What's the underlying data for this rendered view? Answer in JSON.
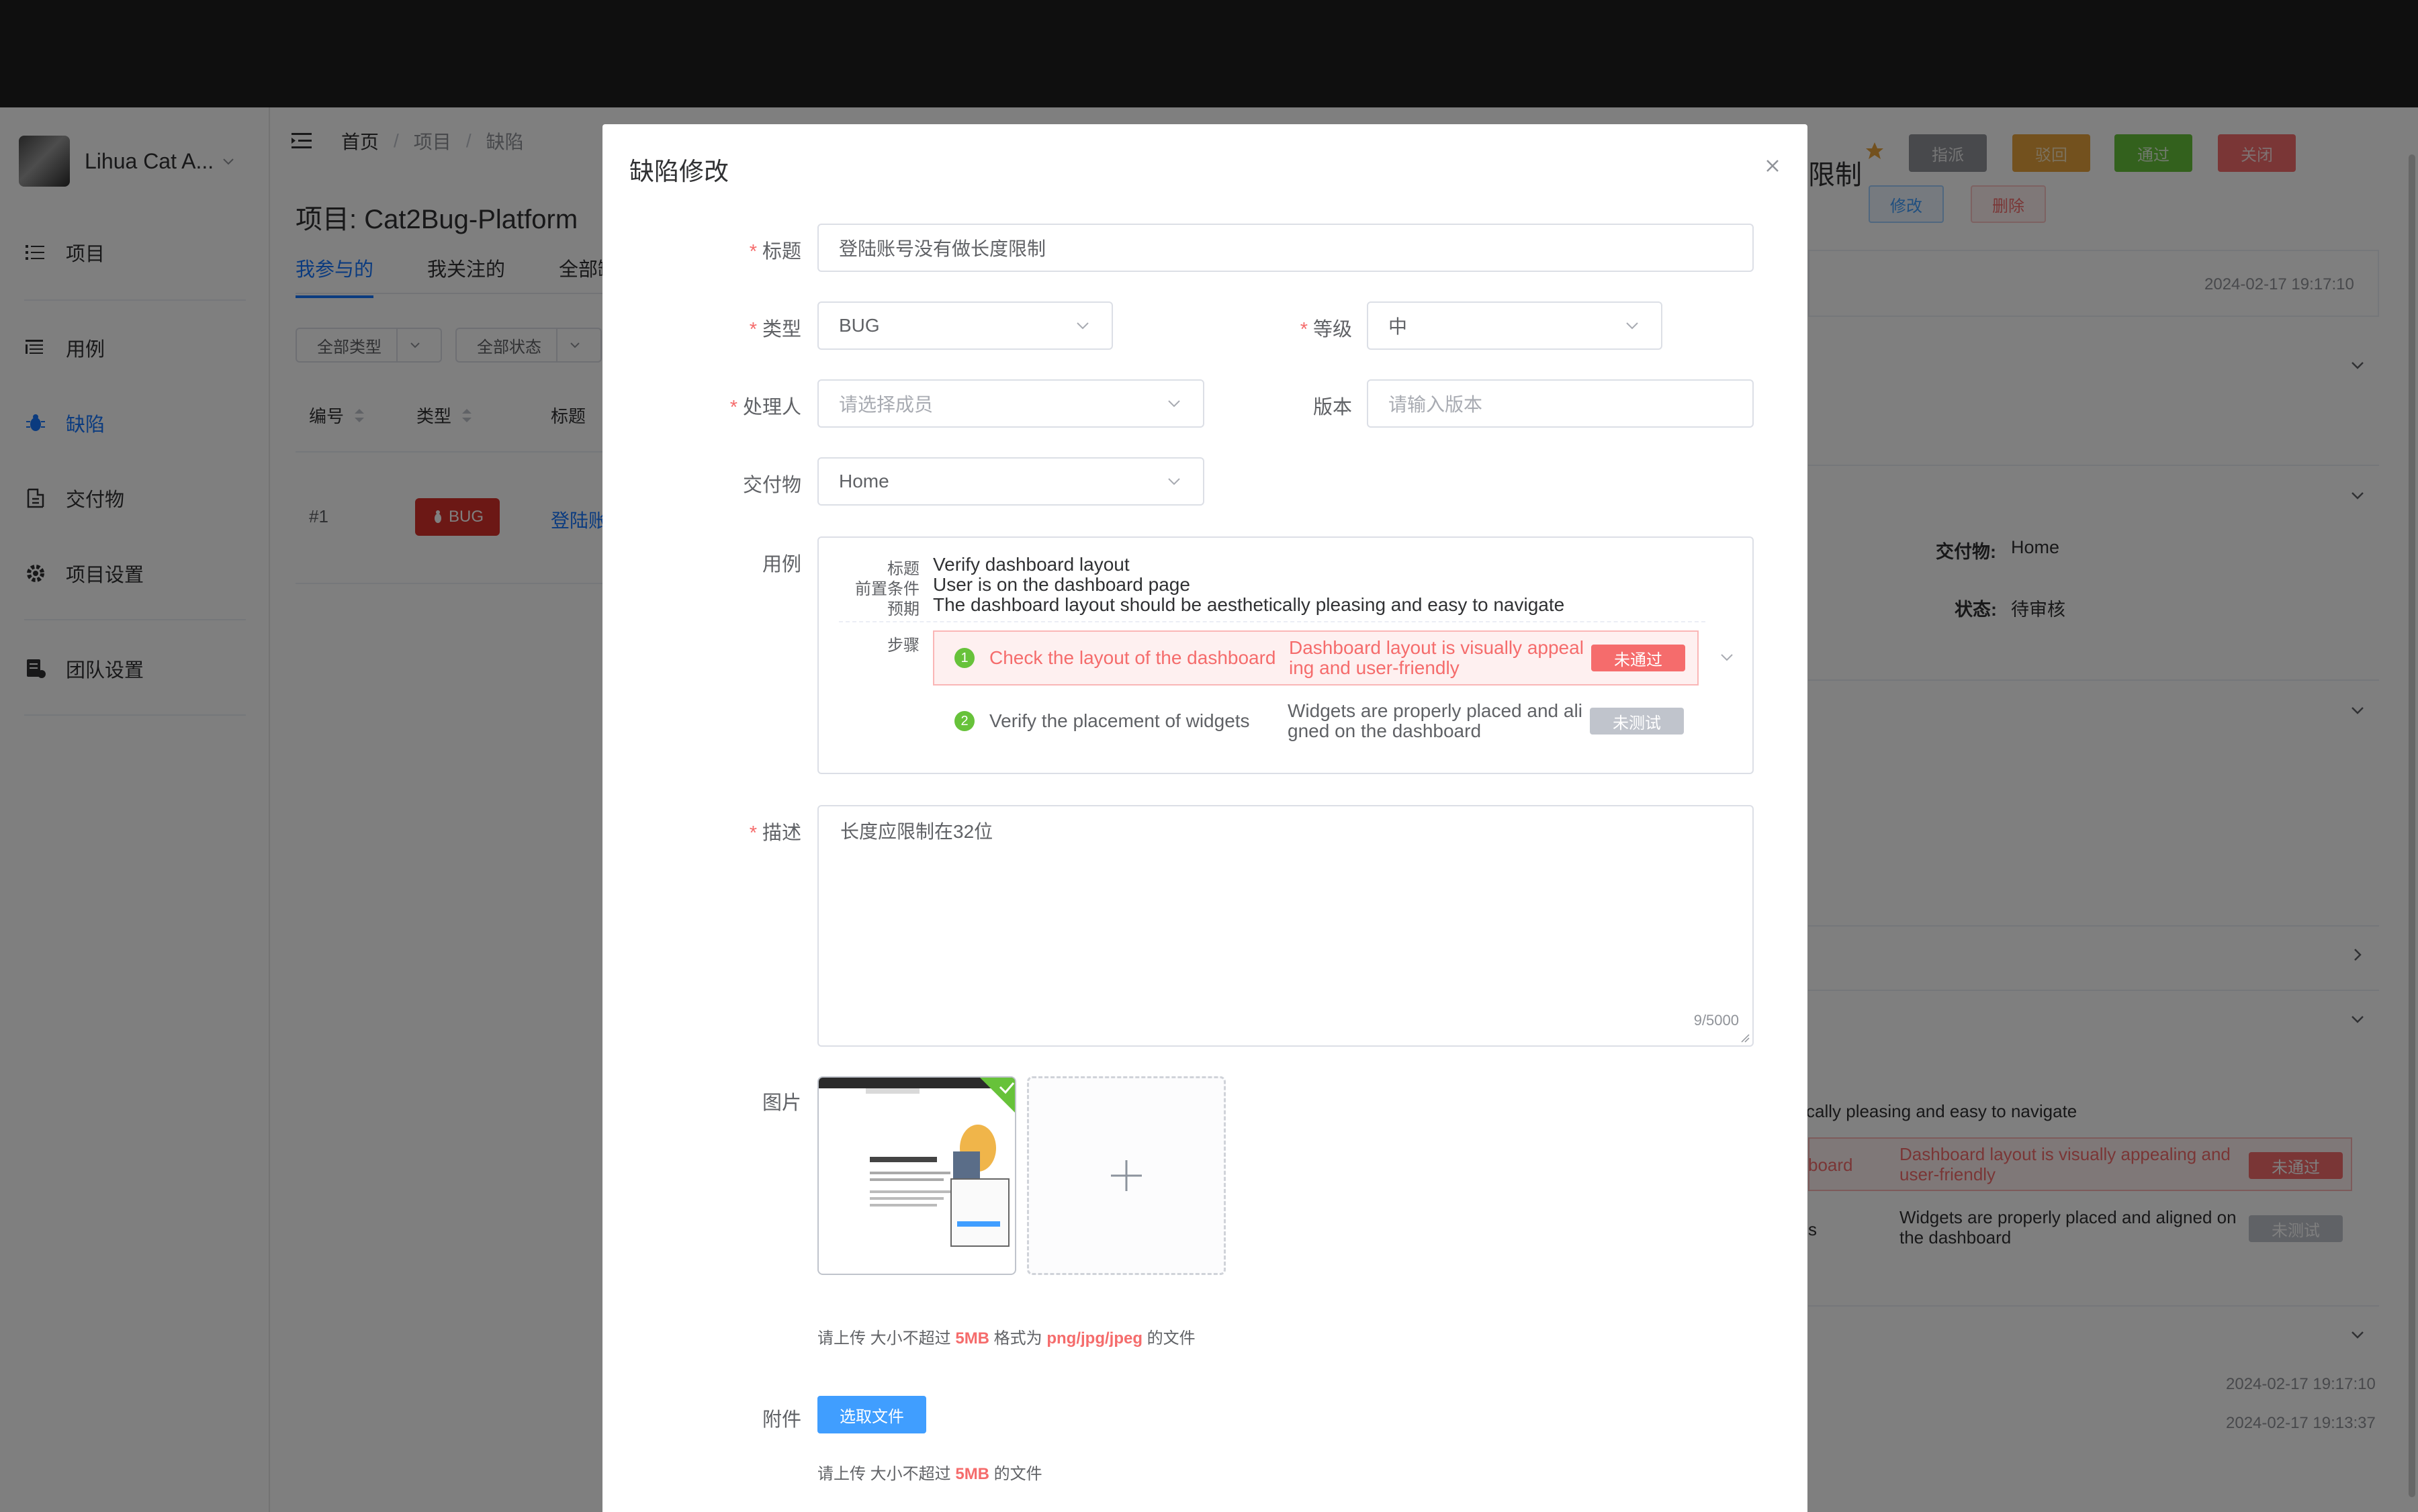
{
  "sidebar": {
    "team_name": "Lihua Cat A...",
    "items": [
      {
        "label": "项目",
        "icon": "list-icon"
      },
      {
        "label": "用例",
        "icon": "tasks-icon"
      },
      {
        "label": "缺陷",
        "icon": "bug-icon"
      },
      {
        "label": "交付物",
        "icon": "deliverable-icon"
      },
      {
        "label": "项目设置",
        "icon": "gear-icon"
      },
      {
        "label": "团队设置",
        "icon": "team-settings-icon"
      }
    ]
  },
  "background": {
    "breadcrumb": [
      "首页",
      "项目",
      "缺陷"
    ],
    "project_title": "项目: Cat2Bug-Platform",
    "tabs": [
      "我参与的",
      "我关注的",
      "全部缺"
    ],
    "filters": [
      "全部类型",
      "全部状态"
    ],
    "columns": [
      "编号",
      "类型",
      "标题"
    ],
    "row": {
      "id": "#1",
      "type": "BUG",
      "title": "登陆账"
    },
    "detail": {
      "title_fragment": "限制",
      "buttons": [
        "指派",
        "驳回",
        "通过",
        "关闭",
        "修改",
        "删除"
      ],
      "time1": "2024-02-17 19:17:10",
      "deliverable_label": "交付物:",
      "deliverable_value": "Home",
      "status_label": "状态:",
      "status_value": "待审核",
      "expected_fragment": "tically pleasing and easy to navigate",
      "step1_fragment": "board",
      "step1_result": "Dashboard layout is visually appealing and user-friendly",
      "step1_status": "未通过",
      "step2_fragment": "s",
      "step2_result": "Widgets are properly placed and aligned on the dashboard",
      "step2_status": "未测试",
      "time2": "2024-02-17 19:17:10",
      "time3": "2024-02-17 19:13:37"
    }
  },
  "dialog": {
    "title": "缺陷修改",
    "fields": {
      "title_label": "标题",
      "title_value": "登陆账号没有做长度限制",
      "type_label": "类型",
      "type_value": "BUG",
      "level_label": "等级",
      "level_value": "中",
      "handler_label": "处理人",
      "handler_placeholder": "请选择成员",
      "version_label": "版本",
      "version_placeholder": "请输入版本",
      "deliverable_label": "交付物",
      "deliverable_value": "Home",
      "case_label": "用例",
      "desc_label": "描述",
      "desc_value": "长度应限制在32位",
      "desc_count": "9/5000",
      "image_label": "图片",
      "image_hint": {
        "pre": "请上传 大小不超过 ",
        "size": "5MB",
        "mid": " 格式为 ",
        "fmt": "png/jpg/jpeg",
        "post": " 的文件"
      },
      "attach_label": "附件",
      "attach_button": "选取文件",
      "attach_hint": {
        "pre": "请上传 大小不超过 ",
        "size": "5MB",
        "post": " 的文件"
      }
    },
    "case": {
      "title_key": "标题",
      "title_val": "Verify dashboard layout",
      "pre_key": "前置条件",
      "pre_val": "User is on the dashboard page",
      "exp_key": "预期",
      "exp_val": "The dashboard layout should be aesthetically pleasing and easy to navigate",
      "steps_key": "步骤",
      "steps": [
        {
          "num": "1",
          "text": "Check the layout of the dashboard",
          "expect_l1": "Dashboard layout is visually appeal",
          "expect_l2": "ing and user-friendly",
          "status": "未通过",
          "status_color": "#f56c6c"
        },
        {
          "num": "2",
          "text": "Verify the placement of widgets",
          "expect_l1": "Widgets are properly placed and ali",
          "expect_l2": "gned on the dashboard",
          "status": "未测试",
          "status_color": "#c0c4cc"
        }
      ]
    }
  },
  "colors": {
    "primary": "#409eff",
    "danger": "#f56c6c",
    "success": "#67c23a",
    "warning": "#e6a23c"
  }
}
